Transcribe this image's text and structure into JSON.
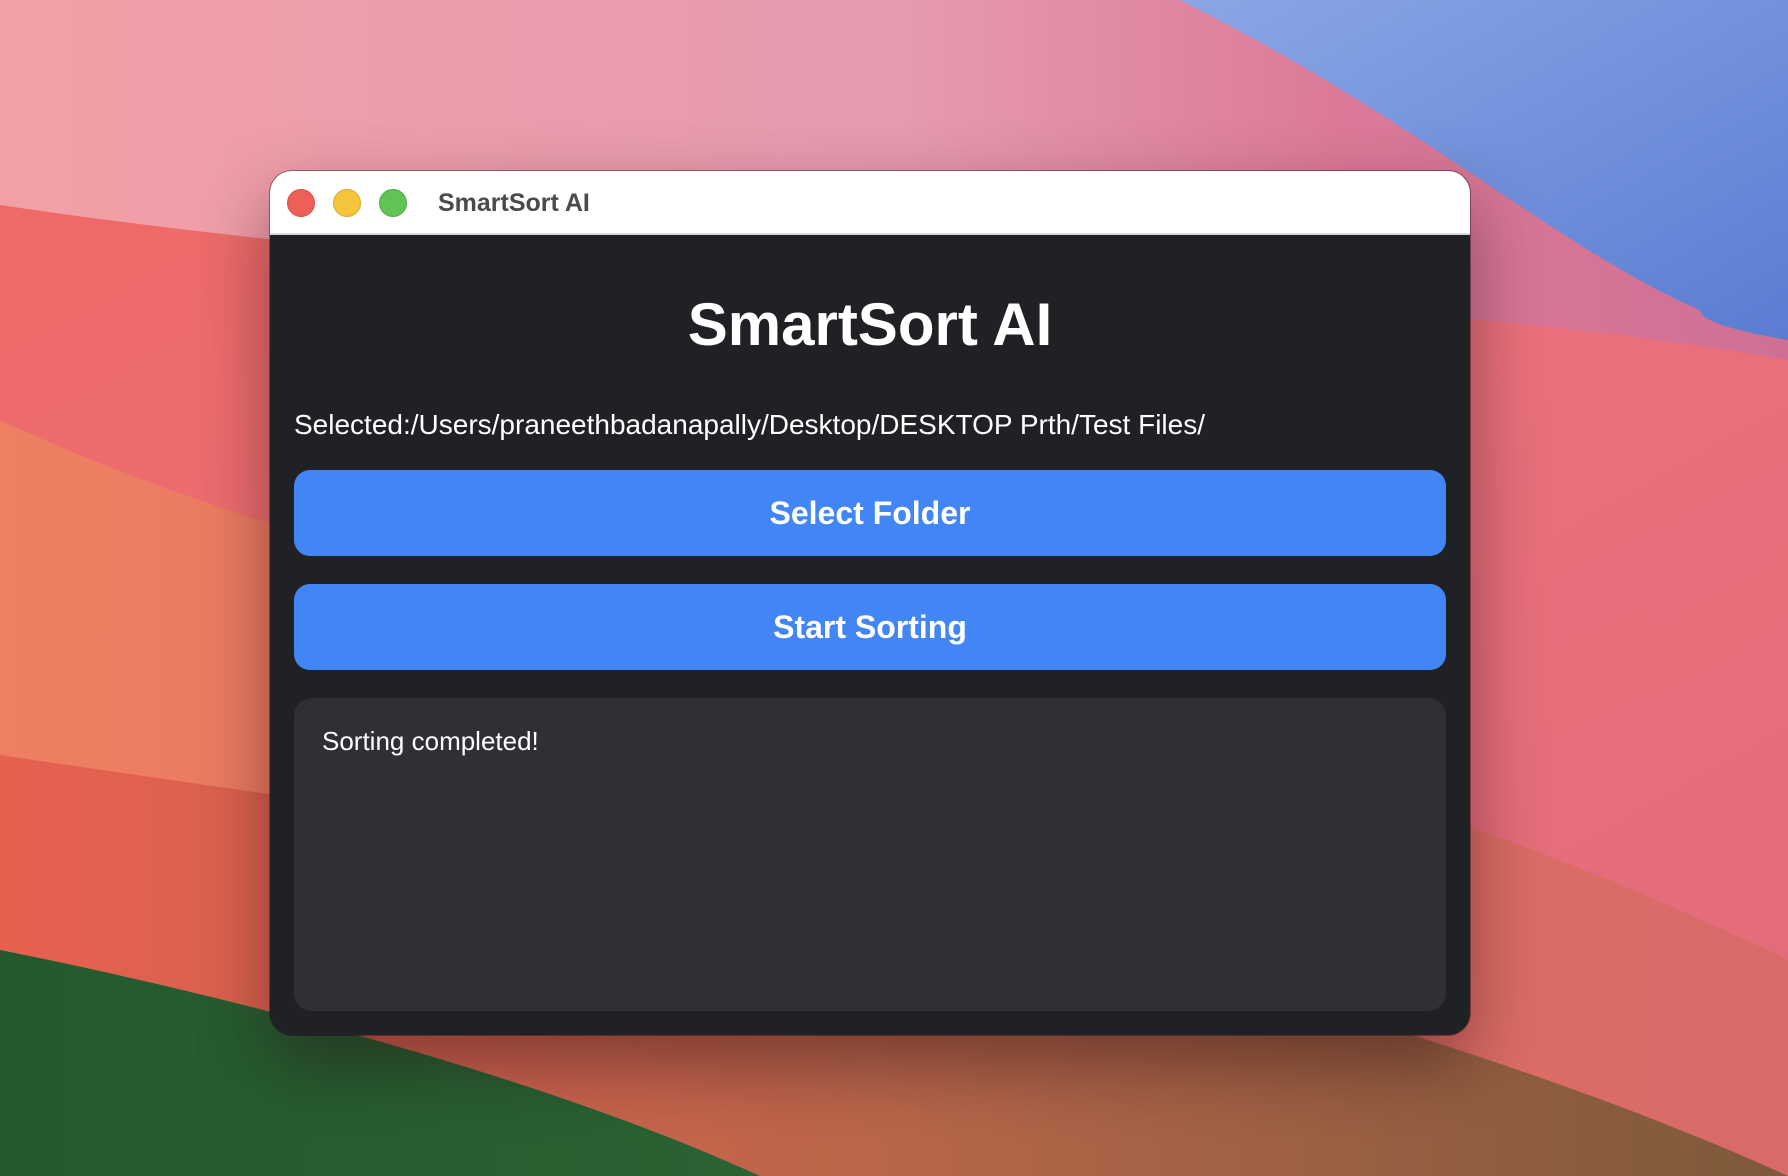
{
  "window": {
    "title": "SmartSort AI"
  },
  "main": {
    "heading": "SmartSort AI",
    "selected_path": "Selected:/Users/praneethbadanapally/Desktop/DESKTOP Prth/Test Files/",
    "select_folder_label": "Select Folder",
    "start_sorting_label": "Start Sorting",
    "log_text": "Sorting completed!"
  },
  "colors": {
    "accent": "#4285f4",
    "window_background": "#202124",
    "log_background": "#2f3034"
  }
}
